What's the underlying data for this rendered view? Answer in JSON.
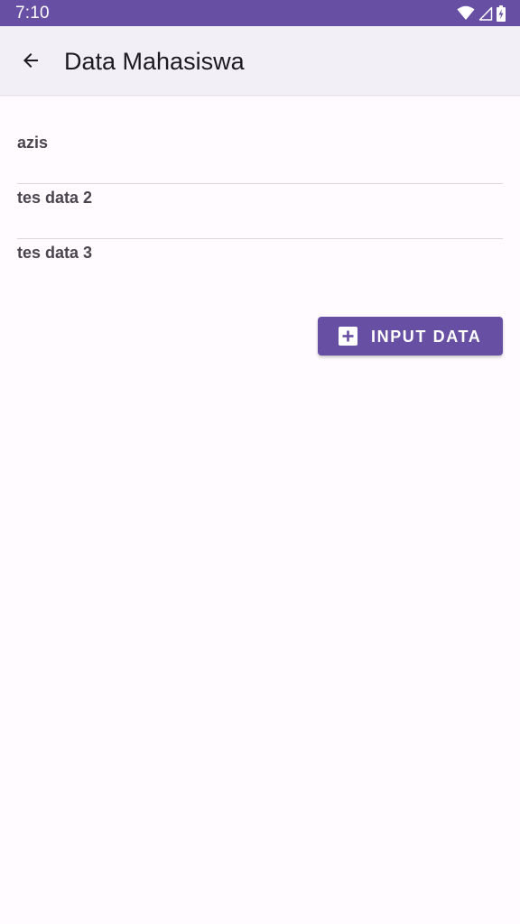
{
  "status_bar": {
    "time": "7:10",
    "icons": [
      "wifi-icon",
      "signal-icon",
      "battery-icon"
    ],
    "background": "#6750A4"
  },
  "app_bar": {
    "back_icon": "arrow-back-icon",
    "title": "Data Mahasiswa",
    "background": "#F2EFF6"
  },
  "students": [
    {
      "name": "azis"
    },
    {
      "name": "tes data 2"
    },
    {
      "name": "tes data 3"
    }
  ],
  "input_button": {
    "icon": "add-box-icon",
    "label": "INPUT DATA",
    "color": "#6750A4"
  }
}
